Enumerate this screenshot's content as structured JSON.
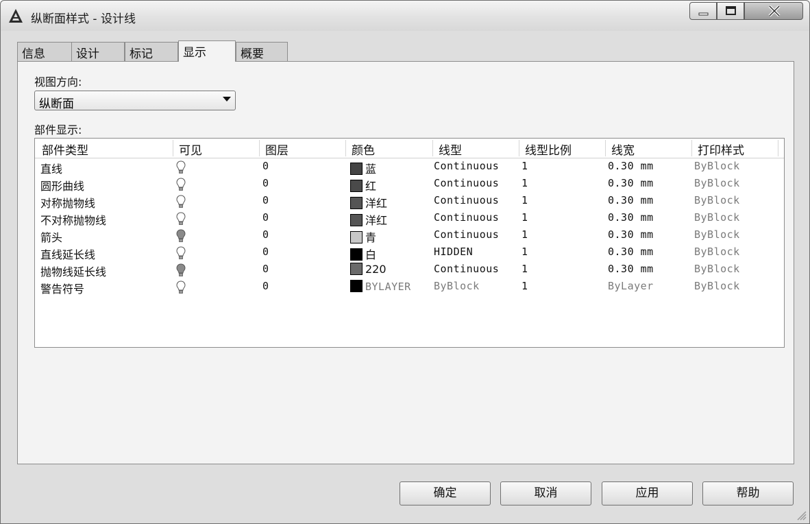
{
  "window": {
    "title": "纵断面样式 - 设计线"
  },
  "tabs": [
    {
      "label": "信息"
    },
    {
      "label": "设计"
    },
    {
      "label": "标记"
    },
    {
      "label": "显示"
    },
    {
      "label": "概要"
    }
  ],
  "active_tab": "显示",
  "view": {
    "direction_label": "视图方向:",
    "direction_value": "纵断面",
    "parts_label": "部件显示:"
  },
  "table": {
    "columns": [
      "部件类型",
      "可见",
      "图层",
      "颜色",
      "线型",
      "线型比例",
      "线宽",
      "打印样式"
    ],
    "rows": [
      {
        "type": "直线",
        "visible": "on",
        "layer": "0",
        "color_name": "蓝",
        "swatch": "#444444",
        "linetype": "Continuous",
        "scale": "1",
        "lineweight": "0.30 mm",
        "plotstyle": "ByBlock"
      },
      {
        "type": "圆形曲线",
        "visible": "on",
        "layer": "0",
        "color_name": "红",
        "swatch": "#4a4a4a",
        "linetype": "Continuous",
        "scale": "1",
        "lineweight": "0.30 mm",
        "plotstyle": "ByBlock"
      },
      {
        "type": "对称抛物线",
        "visible": "on",
        "layer": "0",
        "color_name": "洋红",
        "swatch": "#555555",
        "linetype": "Continuous",
        "scale": "1",
        "lineweight": "0.30 mm",
        "plotstyle": "ByBlock"
      },
      {
        "type": "不对称抛物线",
        "visible": "on",
        "layer": "0",
        "color_name": "洋红",
        "swatch": "#555555",
        "linetype": "Continuous",
        "scale": "1",
        "lineweight": "0.30 mm",
        "plotstyle": "ByBlock"
      },
      {
        "type": "箭头",
        "visible": "off",
        "layer": "0",
        "color_name": "青",
        "swatch": "#c8c8c8",
        "linetype": "Continuous",
        "scale": "1",
        "lineweight": "0.30 mm",
        "plotstyle": "ByBlock"
      },
      {
        "type": "直线延长线",
        "visible": "on",
        "layer": "0",
        "color_name": "白",
        "swatch": "#000000",
        "linetype": "HIDDEN",
        "scale": "1",
        "lineweight": "0.30 mm",
        "plotstyle": "ByBlock"
      },
      {
        "type": "抛物线延长线",
        "visible": "off",
        "layer": "0",
        "color_name": "220",
        "swatch": "#6a6a6a",
        "linetype": "Continuous",
        "scale": "1",
        "lineweight": "0.30 mm",
        "plotstyle": "ByBlock"
      },
      {
        "type": "警告符号",
        "visible": "on",
        "layer": "0",
        "color_name": "BYLAYER",
        "swatch": "#000000",
        "linetype": "ByBlock",
        "scale": "1",
        "lineweight": "ByLayer",
        "plotstyle": "ByBlock"
      }
    ]
  },
  "buttons": {
    "ok": "确定",
    "cancel": "取消",
    "apply": "应用",
    "help": "帮助"
  }
}
